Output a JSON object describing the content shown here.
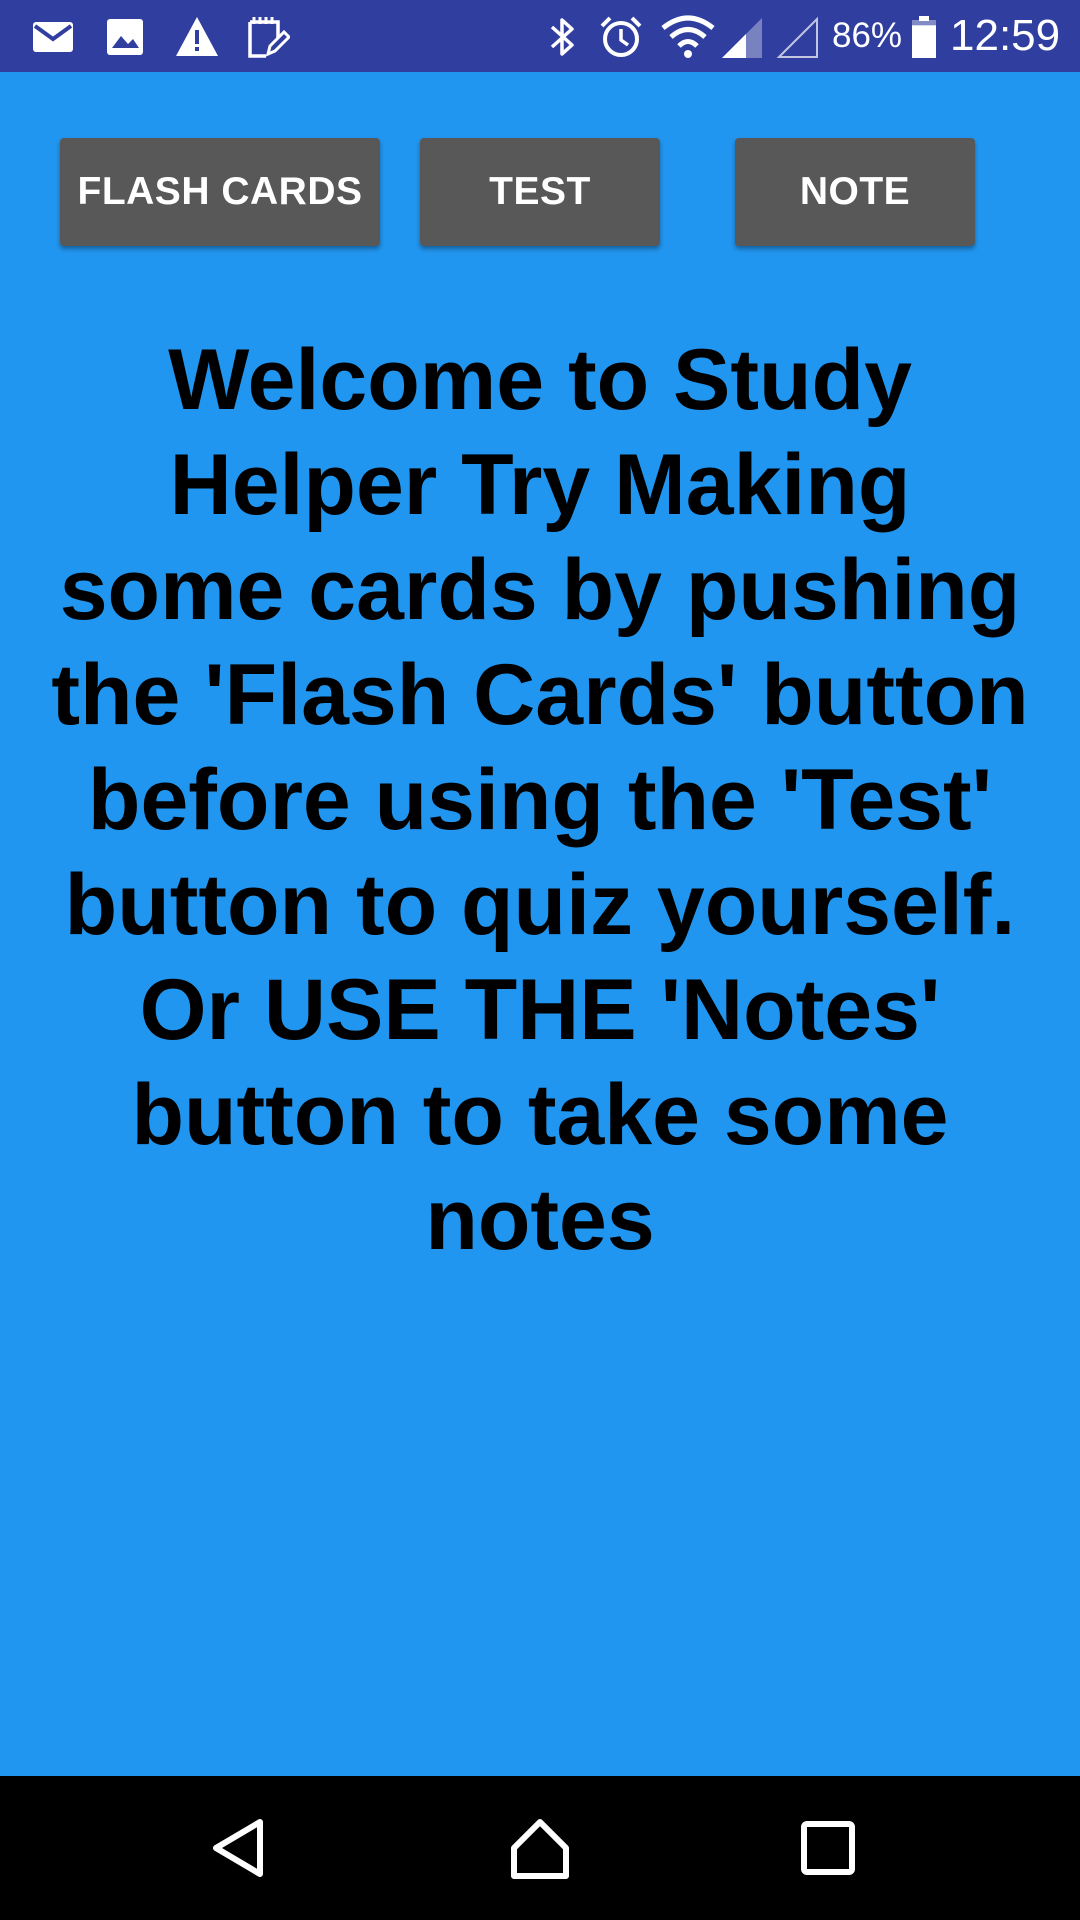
{
  "status_bar": {
    "left_icons": [
      "mail-icon",
      "image-icon",
      "warning-icon",
      "notepad-icon"
    ],
    "right_icons": [
      "bluetooth-icon",
      "alarm-icon",
      "wifi-icon",
      "cell-signal-icon",
      "cell-signal-empty-icon",
      "battery-icon"
    ],
    "battery_percent": "86%",
    "battery_level": 0.86,
    "time": "12:59",
    "background_color": "#303f9f"
  },
  "toolbar": {
    "flash_cards_label": "FLASH CARDS",
    "test_label": "TEST",
    "note_label": "NOTE",
    "button_color": "#585858"
  },
  "main": {
    "welcome_text": "Welcome to Study Helper Try Making some cards by pushing the 'Flash Cards' button before using the 'Test' button to quiz yourself. Or USE THE 'Notes' button to take some notes",
    "background_color": "#2196f0"
  },
  "nav_bar": {
    "icons": [
      "back-icon",
      "home-icon",
      "recents-icon"
    ]
  }
}
